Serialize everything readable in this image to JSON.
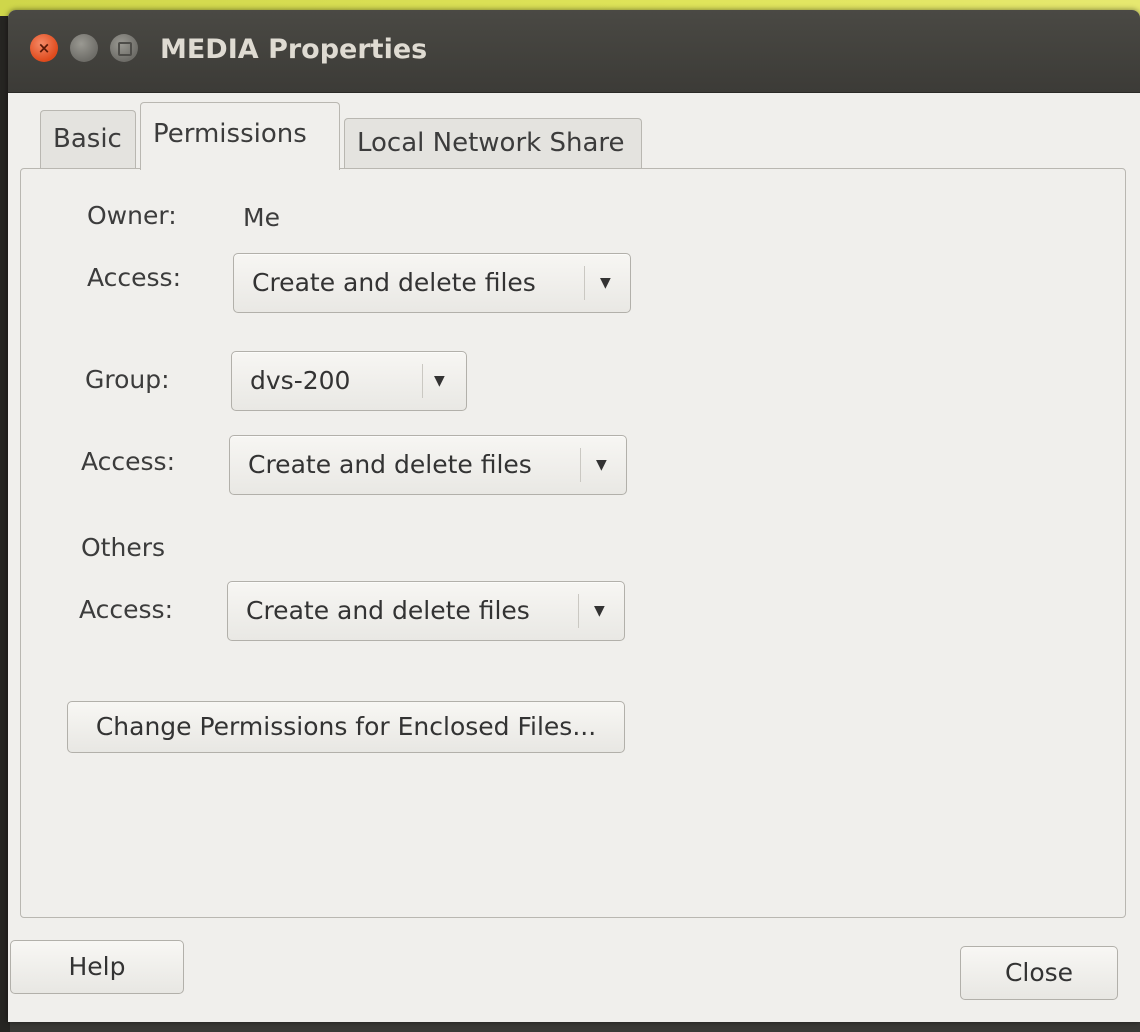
{
  "window": {
    "title": "MEDIA Properties"
  },
  "tabs": [
    {
      "label": "Basic"
    },
    {
      "label": "Permissions"
    },
    {
      "label": "Local Network Share"
    }
  ],
  "permissions": {
    "owner_label": "Owner:",
    "owner_value": "Me",
    "owner_access_label": "Access:",
    "owner_access_value": "Create and delete files",
    "group_label": "Group:",
    "group_value": "dvs-200",
    "group_access_label": "Access:",
    "group_access_value": "Create and delete files",
    "others_label": "Others",
    "others_access_label": "Access:",
    "others_access_value": "Create and delete files",
    "enclosed_button_label": "Change Permissions for Enclosed Files..."
  },
  "footer": {
    "help_label": "Help",
    "close_label": "Close"
  },
  "icons": {
    "dropdown": "chevron-down-icon"
  }
}
